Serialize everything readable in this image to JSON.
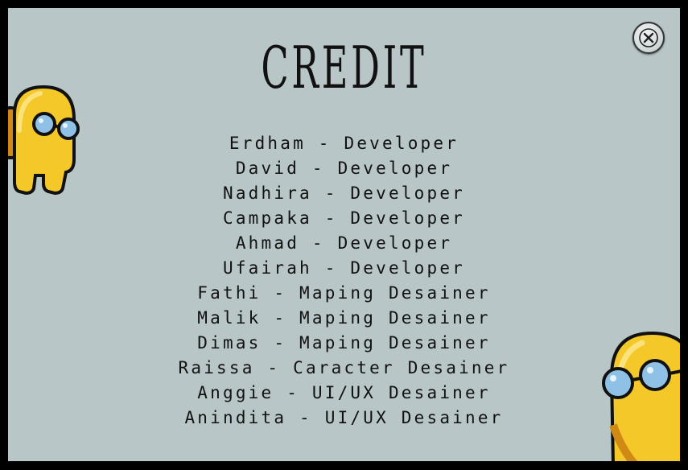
{
  "screen": {
    "title": "CREDIT",
    "close_icon": "close-x-icon",
    "colors": {
      "panel_bg": "#b9c6c8",
      "border": "#000000",
      "text": "#111111",
      "character_yellow": "#f5c82a",
      "visor_blue": "#8fc1e6"
    }
  },
  "credits": [
    "Erdham - Developer",
    "David - Developer",
    "Nadhira - Developer",
    "Campaka - Developer",
    "Ahmad - Developer",
    "Ufairah - Developer",
    "Fathi - Maping Desainer",
    "Malik - Maping Desainer",
    "Dimas - Maping Desainer",
    "Raissa - Caracter Desainer",
    "Anggie - UI/UX Desainer",
    "Anindita - UI/UX Desainer"
  ],
  "decorations": [
    "crewmate-character-icon",
    "crewmate-character-icon"
  ]
}
